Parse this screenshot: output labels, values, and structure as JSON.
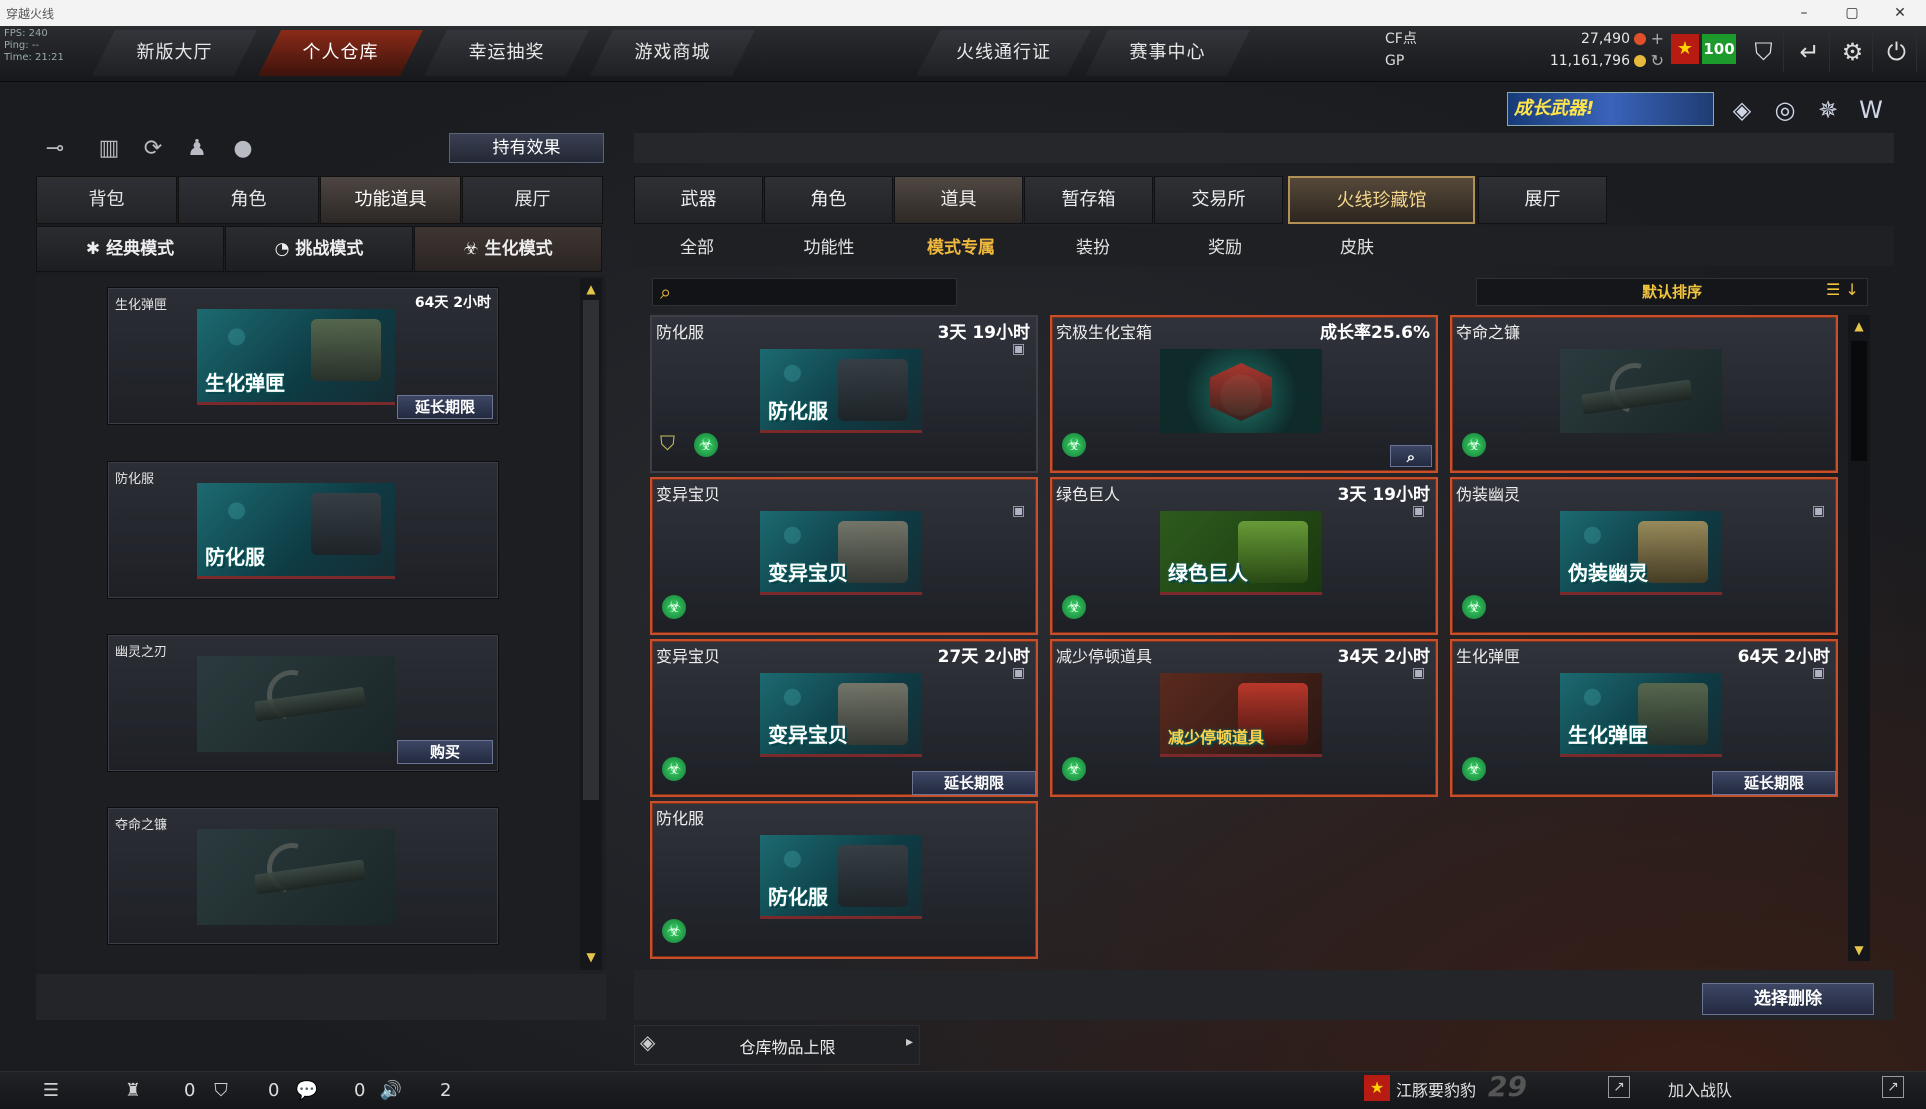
{
  "window": {
    "title": "穿越火线",
    "stats": {
      "fps": "FPS: 240",
      "ping": "Ping: --",
      "time": "Time: 21:21"
    }
  },
  "top_nav": {
    "tabs": [
      {
        "label": "新版大厅",
        "active": false
      },
      {
        "label": "个人仓库",
        "active": true
      },
      {
        "label": "幸运抽奖",
        "active": false
      },
      {
        "label": "游戏商城",
        "active": false
      },
      {
        "label": "火线通行证",
        "active": false
      },
      {
        "label": "赛事中心",
        "active": false
      }
    ]
  },
  "currency": {
    "cf_label": "CF点",
    "cf_value": "27,490",
    "gp_label": "GP",
    "gp_value": "11,161,796"
  },
  "rank_badge": "100",
  "banner": {
    "text": "成长武器!"
  },
  "left_panel": {
    "hold_effect_button": "持有效果",
    "tabs": [
      "背包",
      "角色",
      "功能道具",
      "展厅"
    ],
    "active_tab": "功能道具",
    "mode_tabs": [
      "经典模式",
      "挑战模式",
      "生化模式"
    ],
    "active_mode": "生化模式",
    "items": [
      {
        "name": "生化弹匣",
        "time": "64天 2小时",
        "image_label": "生化弹匣",
        "action": "延长期限"
      },
      {
        "name": "防化服",
        "time": "",
        "image_label": "防化服",
        "action": ""
      },
      {
        "name": "幽灵之刃",
        "time": "",
        "image_label": "",
        "action": "购买"
      },
      {
        "name": "夺命之镰",
        "time": "",
        "image_label": "",
        "action": ""
      }
    ]
  },
  "right_panel": {
    "tabs": [
      "武器",
      "角色",
      "道具",
      "暂存箱",
      "交易所",
      "火线珍藏馆",
      "展厅"
    ],
    "active_tab": "道具",
    "sub_tabs": [
      "全部",
      "功能性",
      "模式专属",
      "装扮",
      "奖励",
      "皮肤"
    ],
    "active_sub_tab": "模式专属",
    "search_placeholder": "",
    "sort_label": "默认排序",
    "items": [
      {
        "name": "防化服",
        "time": "3天 19小时",
        "image_label": "防化服",
        "action": "",
        "lock": true,
        "shield": true
      },
      {
        "name": "究极生化宝箱",
        "time": "成长率25.6%",
        "image_label": "",
        "action": "",
        "lock": false,
        "magnify": true
      },
      {
        "name": "夺命之镰",
        "time": "",
        "image_label": "",
        "action": "",
        "lock": false
      },
      {
        "name": "变异宝贝",
        "time": "",
        "image_label": "变异宝贝",
        "action": "",
        "lock": true
      },
      {
        "name": "绿色巨人",
        "time": "3天 19小时",
        "image_label": "绿色巨人",
        "action": "",
        "lock": true
      },
      {
        "name": "伪装幽灵",
        "time": "",
        "image_label": "伪装幽灵",
        "action": "",
        "lock": true
      },
      {
        "name": "变异宝贝",
        "time": "27天 2小时",
        "image_label": "变异宝贝",
        "action": "延长期限",
        "lock": true
      },
      {
        "name": "减少停顿道具",
        "time": "34天 2小时",
        "image_label": "减少停顿道具",
        "action": "",
        "lock": true
      },
      {
        "name": "生化弹匣",
        "time": "64天 2小时",
        "image_label": "生化弹匣",
        "action": "延长期限",
        "lock": true
      },
      {
        "name": "防化服",
        "time": "",
        "image_label": "防化服",
        "action": "",
        "lock": false
      }
    ],
    "delete_button": "选择删除",
    "capacity_label": "仓库物品上限"
  },
  "status_bar": {
    "count1": "0",
    "count2": "0",
    "count3": "0",
    "count4": "2",
    "player_name": "江豚要豹豹",
    "player_level": "29",
    "join_label": "加入战队"
  }
}
